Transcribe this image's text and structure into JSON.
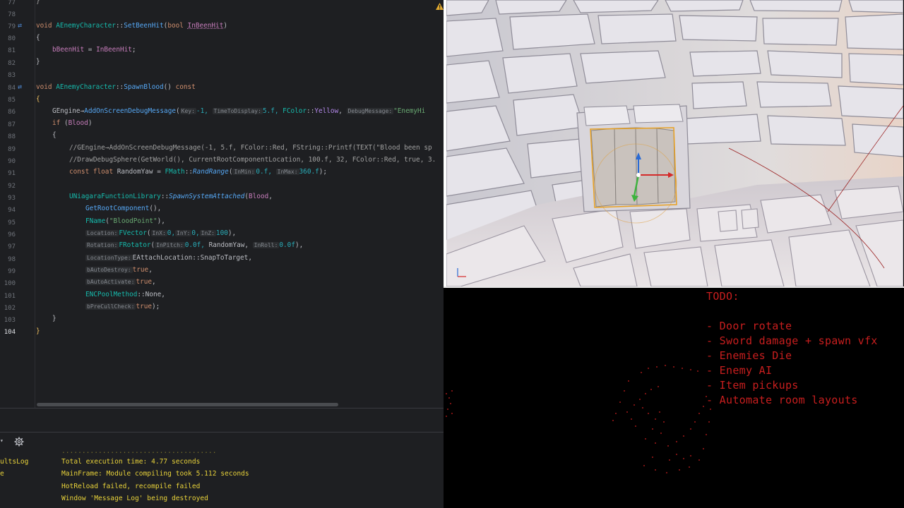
{
  "editor": {
    "line_numbers": [
      "77",
      "78",
      "79",
      "80",
      "81",
      "82",
      "83",
      "84",
      "85",
      "86",
      "87",
      "88",
      "89",
      "90",
      "91",
      "92",
      "93",
      "94",
      "95",
      "96",
      "97",
      "98",
      "99",
      "100",
      "101",
      "102",
      "103",
      "104"
    ],
    "line_78_a": "void ",
    "line_78_cls": "AEnemyCharacter",
    "line_78_sep": "::",
    "line_78_fn": "SetBeenHit",
    "line_78_paren": "(",
    "line_78_kw": "bool ",
    "line_78_param": "InBeenHit",
    "line_78_close": ")",
    "line_79": "{",
    "line_80_var": "bBeenHit",
    "line_80_eq": " = ",
    "line_80_param": "InBeenHit",
    "line_80_end": ";",
    "line_81": "}",
    "line_83_a": "void ",
    "line_83_cls": "AEnemyCharacter",
    "line_83_sep": "::",
    "line_83_fn": "SpawnBlood",
    "line_83_paren": "() ",
    "line_83_kw": "const",
    "line_84": "{",
    "line_85_obj": "GEngine",
    "line_85_arrow": "→",
    "line_85_fn": "AddOnScreenDebugMessage",
    "line_85_open": "(",
    "line_85_h1": "Key:",
    "line_85_v1": "-1, ",
    "line_85_h2": "TimeToDisplay:",
    "line_85_v2": "5.f, ",
    "line_85_cls": "FColor",
    "line_85_sep": "::",
    "line_85_color": "Yellow",
    "line_85_comma": ", ",
    "line_85_h3": "DebugMessage:",
    "line_85_str": "\"EnemyHi",
    "line_86_kw": "if ",
    "line_86_open": "(",
    "line_86_var": "Blood",
    "line_86_close": ")",
    "line_87": "{",
    "line_88": "//GEngine→AddOnScreenDebugMessage(-1, 5.f, FColor::Red, FString::Printf(TEXT(\"Blood been sp",
    "line_89": "//DrawDebugSphere(GetWorld(), CurrentRootComponentLocation, 100.f, 32, FColor::Red, true, 3.",
    "line_90_kw": "const float ",
    "line_90_var": "RandomYaw",
    "line_90_eq": " = ",
    "line_90_cls": "FMath",
    "line_90_sep": "::",
    "line_90_fn": "RandRange",
    "line_90_open": "(",
    "line_90_h1": "InMin:",
    "line_90_v1": "0.f, ",
    "line_90_h2": "InMax:",
    "line_90_v2": "360.f",
    "line_90_close": ");",
    "line_92_cls": "UNiagaraFunctionLibrary",
    "line_92_sep": "::",
    "line_92_fn": "SpawnSystemAttached",
    "line_92_open": "(",
    "line_92_var": "Blood",
    "line_92_comma": ",",
    "line_93_fn": "GetRootComponent",
    "line_93_end": "(),",
    "line_94_cls": "FName",
    "line_94_open": "(",
    "line_94_str": "\"BloodPoint\"",
    "line_94_close": "),",
    "line_95_h": "Location:",
    "line_95_cls": "FVector",
    "line_95_open": "(",
    "line_95_h1": "InX:",
    "line_95_v1": "0,",
    "line_95_h2": "InY:",
    "line_95_v2": "0,",
    "line_95_h3": "InZ:",
    "line_95_v3": "100",
    "line_95_close": "),",
    "line_96_h": "Rotation:",
    "line_96_cls": "FRotator",
    "line_96_open": "(",
    "line_96_h1": "InPitch:",
    "line_96_v1": "0.0f, ",
    "line_96_var": "RandomYaw, ",
    "line_96_h2": "InRoll:",
    "line_96_v2": "0.0f",
    "line_96_close": "),",
    "line_97_h": "LocationType:",
    "line_97_cls": "EAttachLocation",
    "line_97_sep": "::",
    "line_97_val": "SnapToTarget,",
    "line_98_h": "bAutoDestroy:",
    "line_98_v": "true",
    "line_98_end": ",",
    "line_99_h": "bAutoActivate:",
    "line_99_v": "true",
    "line_99_end": ",",
    "line_100_cls": "ENCPoolMethod",
    "line_100_sep": "::",
    "line_100_val": "None,",
    "line_101_h": "bPreCullCheck:",
    "line_101_v": "true",
    "line_101_end": ");",
    "line_102": "}",
    "line_103": "}"
  },
  "console": {
    "side_labels": [
      "ultsLog",
      "e"
    ],
    "lines": [
      "Total execution time: 4.77 seconds",
      "MainFrame: Module compiling took 5.112 seconds",
      "HotReload failed, recompile failed",
      "Window 'Message Log' being destroyed"
    ]
  },
  "todo": {
    "title": "TODO:",
    "items": [
      "- Door rotate",
      "- Sword damage + spawn vfx",
      "- Enemies Die",
      "- Enemy AI",
      "- Item pickups",
      "- Automate room layouts"
    ]
  },
  "colors": {
    "todo_red": "#c81e1e",
    "console_yellow": "#e8d23a",
    "editor_bg": "#1e1f22",
    "gizmo_x": "#d42a2a",
    "gizmo_y": "#3db33d",
    "gizmo_z": "#2a6ad4",
    "selection_outline": "#e8a020"
  },
  "icons": {
    "warning": "warning-icon",
    "gear": "gear-icon",
    "method_override": "override-icon"
  }
}
